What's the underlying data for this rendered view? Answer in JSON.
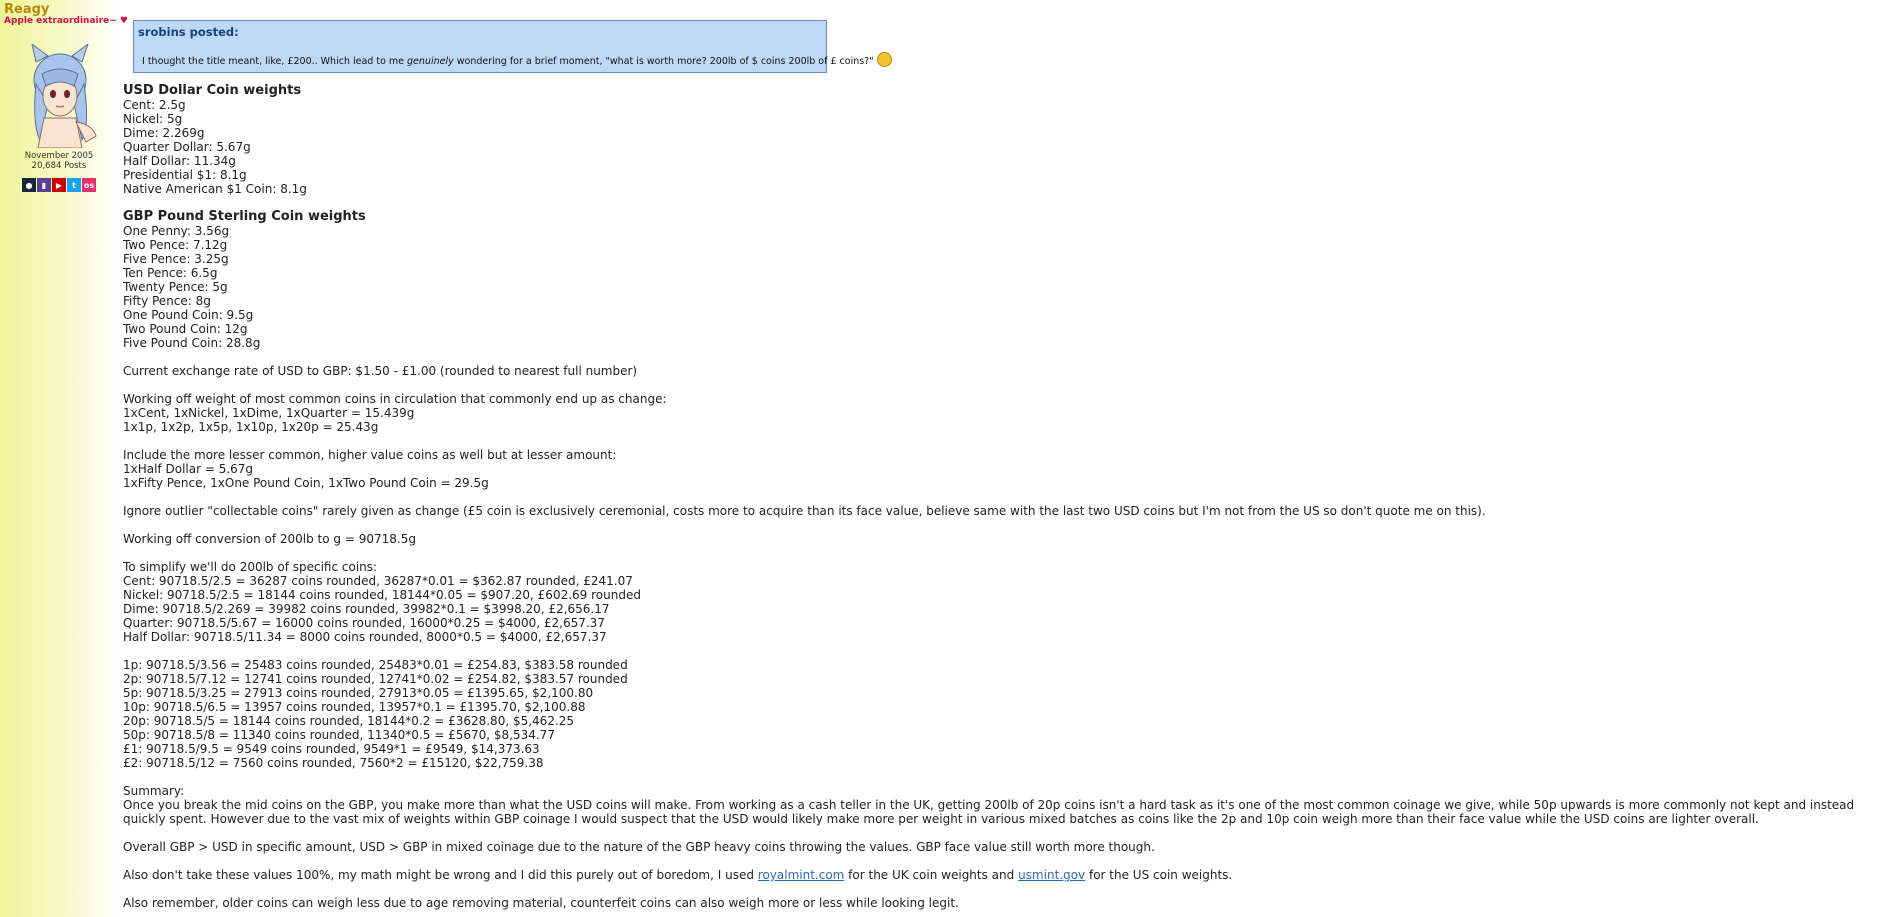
{
  "user": {
    "name": "Reagy",
    "title": "Apple extraordinaire~ ♥",
    "joined": "November 2005",
    "posts": "20,684 Posts",
    "social_icons": [
      "steam-icon",
      "twitch-icon",
      "youtube-icon",
      "twitter-icon",
      "osu-icon"
    ]
  },
  "quote": {
    "header": "srobins posted:",
    "text_before": "I thought the title meant, like, £200.. Which lead to me ",
    "text_em": "genuinely",
    "text_after": " wondering for a brief moment, \"what is worth more? 200lb of $ coins 200lb of £ coins?\""
  },
  "usd": {
    "heading": "USD Dollar Coin weights",
    "lines": [
      "Cent: 2.5g",
      "Nickel: 5g",
      "Dime: 2.269g",
      "Quarter Dollar: 5.67g",
      "Half Dollar: 11.34g",
      "Presidential $1: 8.1g",
      "Native American $1 Coin: 8.1g"
    ]
  },
  "gbp": {
    "heading": "GBP Pound Sterling Coin weights",
    "lines": [
      "One Penny: 3.56g",
      "Two Pence: 7.12g",
      "Five Pence: 3.25g",
      "Ten Pence: 6.5g",
      "Twenty Pence: 5g",
      "Fifty Pence: 8g",
      "One Pound Coin: 9.5g",
      "Two Pound Coin: 12g",
      "Five Pound Coin: 28.8g"
    ]
  },
  "exchange": "Current exchange rate of USD to GBP: $1.50 - £1.00 (rounded to nearest full number)",
  "common": [
    "Working off weight of most common coins in circulation that commonly end up as change:",
    "1xCent, 1xNickel, 1xDime, 1xQuarter = 15.439g",
    "1x1p, 1x2p, 1x5p, 1x10p, 1x20p = 25.43g"
  ],
  "lesser": [
    "Include the more lesser common, higher value coins as well but at lesser amount:",
    "1xHalf Dollar = 5.67g",
    "1xFifty Pence, 1xOne Pound Coin, 1xTwo Pound Coin = 29.5g"
  ],
  "ignore": "Ignore outlier \"collectable coins\" rarely given as change (£5 coin is exclusively ceremonial, costs more to acquire than its face value, believe same with the last two USD coins but I'm not from the US so don't quote me on this).",
  "conversion": "Working off conversion of 200lb to g = 90718.5g",
  "simplify": {
    "intro": "To simplify we'll do 200lb of specific coins:",
    "usd_lines": [
      "Cent: 90718.5/2.5 = 36287 coins rounded, 36287*0.01 = $362.87 rounded, £241.07",
      "Nickel: 90718.5/2.5 = 18144 coins rounded, 18144*0.05 = $907.20, £602.69 rounded",
      "Dime: 90718.5/2.269 = 39982 coins rounded, 39982*0.1 = $3998.20, £2,656.17",
      "Quarter: 90718.5/5.67 = 16000 coins rounded, 16000*0.25 = $4000, £2,657.37",
      "Half Dollar: 90718.5/11.34 = 8000 coins rounded, 8000*0.5 = $4000, £2,657.37"
    ],
    "gbp_lines": [
      "1p: 90718.5/3.56 = 25483 coins rounded, 25483*0.01 = £254.83, $383.58 rounded",
      "2p: 90718.5/7.12 = 12741 coins rounded, 12741*0.02 = £254.82, $383.57 rounded",
      "5p: 90718.5/3.25 = 27913 coins rounded, 27913*0.05 = £1395.65, $2,100.80",
      "10p: 90718.5/6.5 = 13957 coins rounded, 13957*0.1 = £1395.70, $2,100.88",
      "20p: 90718.5/5 = 18144 coins rounded, 18144*0.2 = £3628.80, $5,462.25",
      "50p: 90718.5/8 = 11340 coins rounded, 11340*0.5 = £5670, $8,534.77",
      "£1: 90718.5/9.5 = 9549 coins rounded, 9549*1 = £9549, $14,373.63",
      "£2: 90718.5/12 = 7560 coins rounded, 7560*2 = £15120, $22,759.38"
    ]
  },
  "summary": {
    "label": "Summary:",
    "text": "Once you break the mid coins on the GBP, you make more than what the USD coins will make. From working as a cash teller in the UK, getting 200lb of 20p coins isn't a hard task as it's one of the most common coinage we give, while 50p upwards is more commonly not kept and instead quickly spent. However due to the vast mix of weights within GBP coinage I would suspect that the USD would likely make more per weight in various mixed batches as coins like the 2p and 10p coin weigh more than their face value while the USD coins are lighter overall."
  },
  "overall": "Overall GBP > USD in specific amount, USD > GBP in mixed coinage due to the nature of the GBP heavy coins throwing the values. GBP face value still worth more though.",
  "disclaimer": {
    "before": "Also don't take these values 100%, my math might be wrong and I did this purely out of boredom, I used ",
    "link1": "royalmint.com",
    "middle": " for the UK coin weights and ",
    "link2": "usmint.gov",
    "after": " for the US coin weights."
  },
  "remember": "Also remember, older coins can weigh less due to age removing material, counterfeit coins can also weigh more or less while looking legit."
}
